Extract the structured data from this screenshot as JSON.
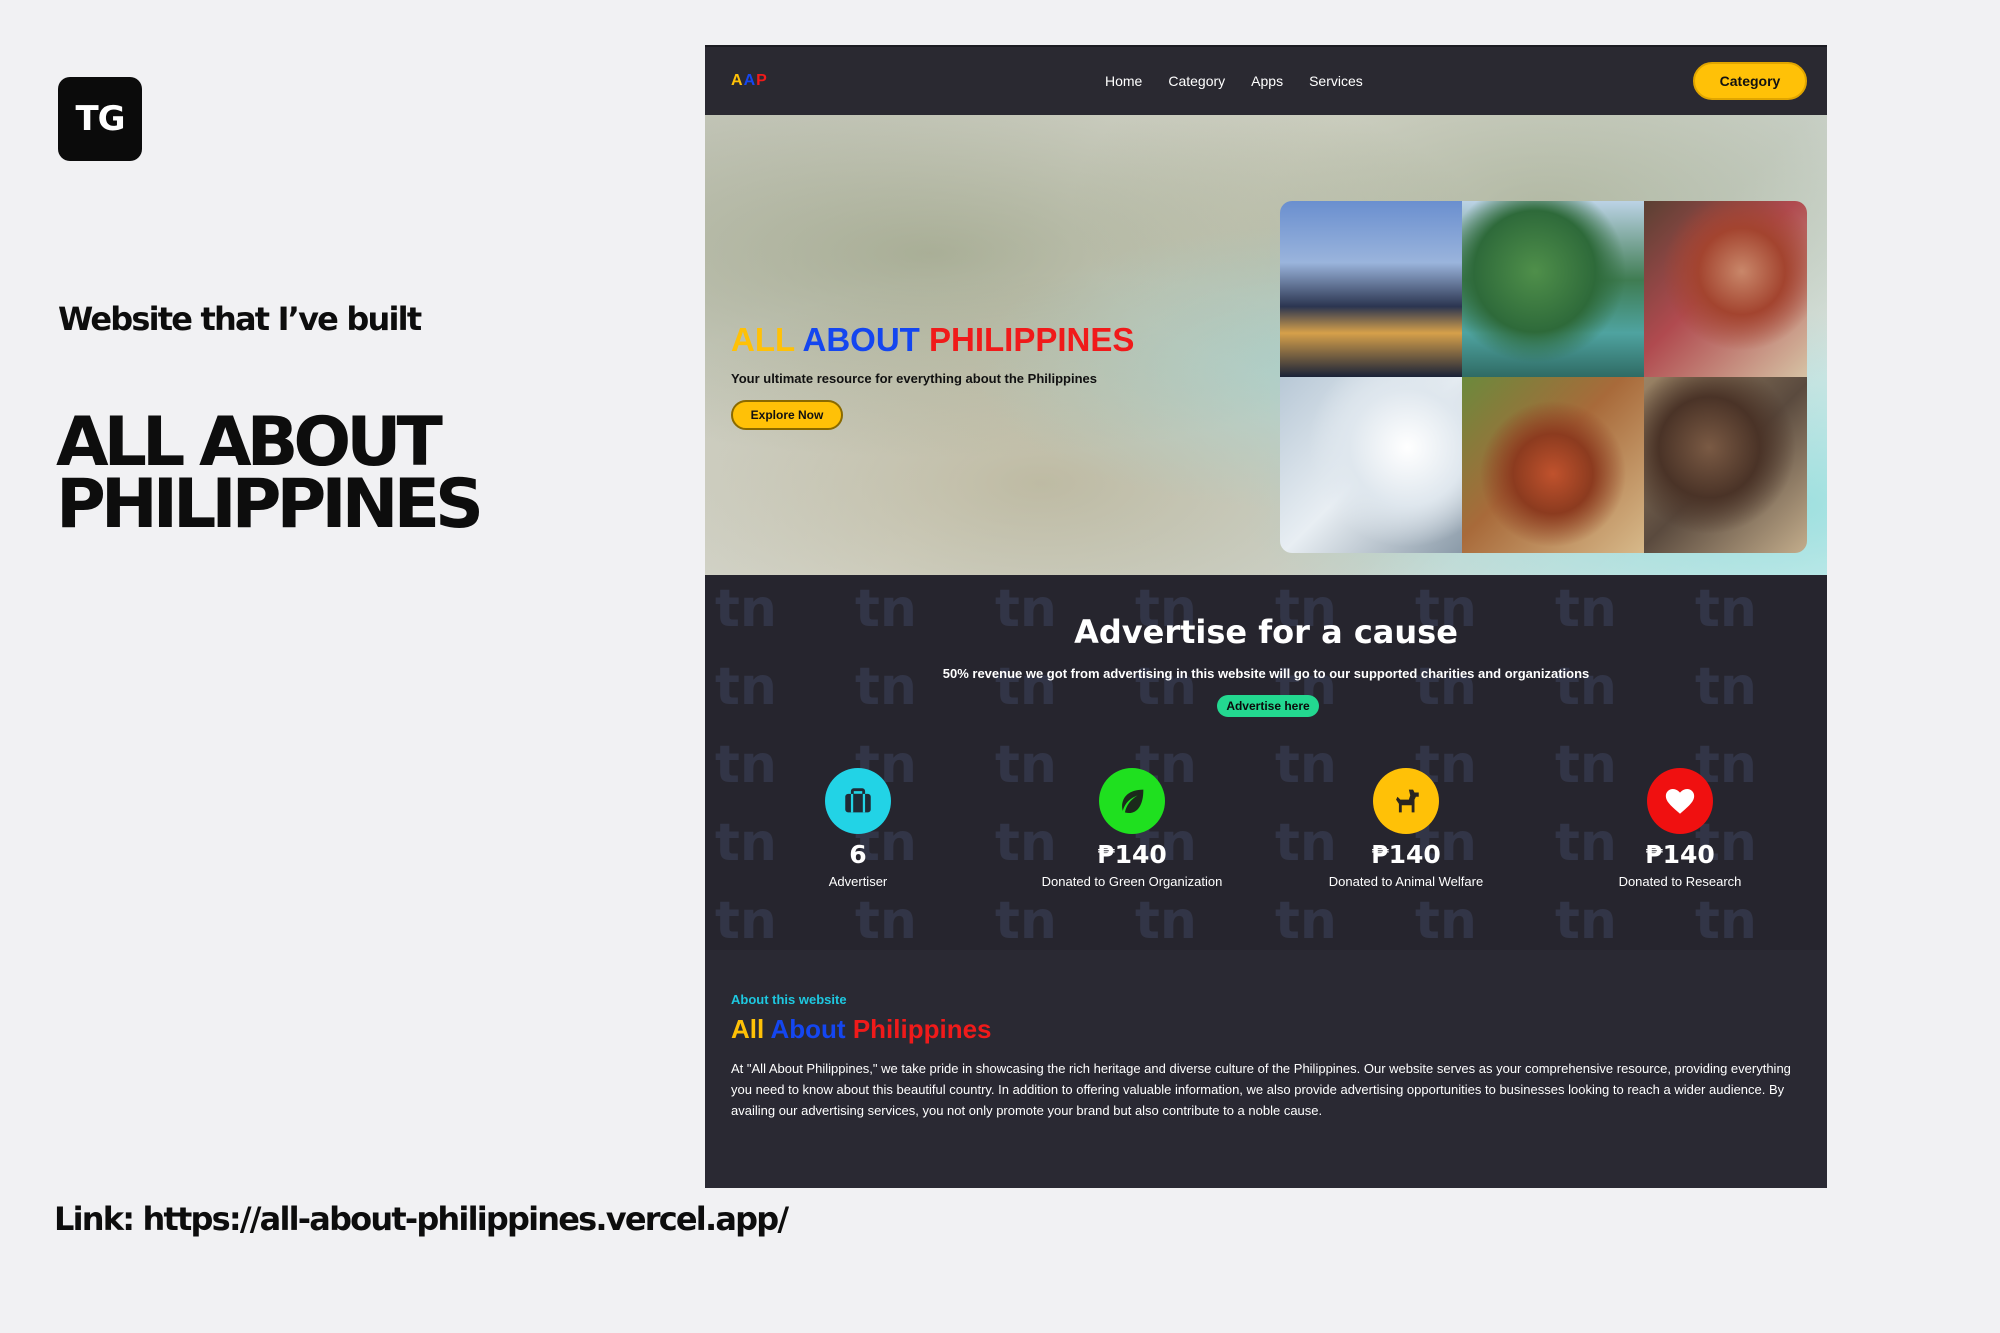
{
  "slide": {
    "logo_text": "TG",
    "intro": "Website that I’ve built",
    "title_line1": "ALL ABOUT",
    "title_line2": "PHILIPPINES",
    "link": "Link: https://all-about-philippines.vercel.app/"
  },
  "site": {
    "nav": {
      "brand": [
        "A",
        "A",
        "P"
      ],
      "brand_colors": [
        "#ffc107",
        "#1446f0",
        "#f01a1a"
      ],
      "links": [
        "Home",
        "Category",
        "Apps",
        "Services"
      ],
      "cta": "Category"
    },
    "hero": {
      "title": [
        "ALL",
        "ABOUT",
        "PHILIPPINES"
      ],
      "title_colors": [
        "#ffc107",
        "#1446f0",
        "#f01a1a"
      ],
      "subtitle": "Your ultimate resource for everything about the Philippines",
      "button": "Explore Now"
    },
    "cause": {
      "title": "Advertise for a cause",
      "subtitle": "50% revenue we got from advertising in this website will go to our supported charities and organizations",
      "button": "Advertise here",
      "stats": [
        {
          "icon": "briefcase-icon",
          "color": "#22d3e6",
          "value": "6",
          "label": "Advertiser"
        },
        {
          "icon": "leaf-icon",
          "color": "#1fe01f",
          "value": "₱140",
          "label": "Donated to Green Organization"
        },
        {
          "icon": "dog-icon",
          "color": "#ffc107",
          "value": "₱140",
          "label": "Donated to Animal Welfare"
        },
        {
          "icon": "heart-icon",
          "color": "#f01010",
          "value": "₱140",
          "label": "Donated to Research"
        }
      ]
    },
    "about": {
      "kicker": "About this website",
      "title": [
        "All",
        "About",
        "Philippines"
      ],
      "title_colors": [
        "#ffc107",
        "#1446f0",
        "#f01a1a"
      ],
      "body": "At \"All About Philippines,\" we take pride in showcasing the rich heritage and diverse culture of the Philippines. Our website serves as your comprehensive resource, providing everything you need to know about this beautiful country. In addition to offering valuable information, we also provide advertising opportunities to businesses looking to reach a wider audience. By availing our advertising services, you not only promote your brand but also contribute to a noble cause."
    }
  }
}
